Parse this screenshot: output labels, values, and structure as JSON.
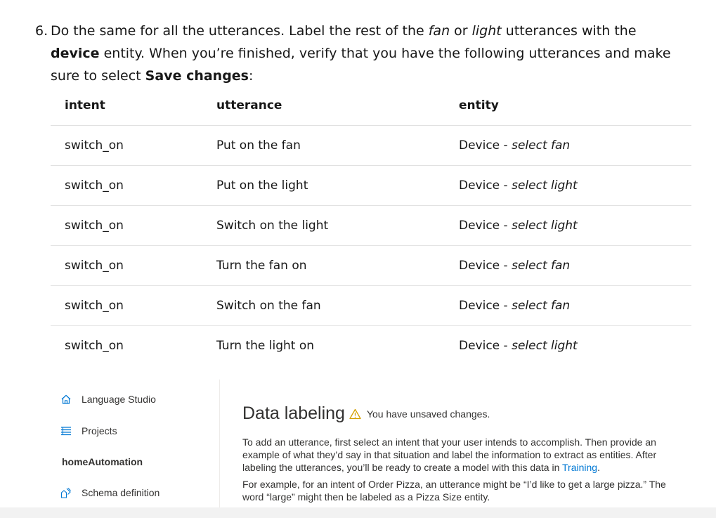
{
  "step": {
    "number": "6.",
    "t1": "Do the same for all the utterances. Label the rest of the ",
    "t2": "fan",
    "t3": " or ",
    "t4": "light",
    "t5": " utterances with the ",
    "t6": "device",
    "t7": " entity. When you’re finished, verify that you have the following utterances and make sure to select ",
    "t8": "Save changes",
    "t9": ":"
  },
  "table": {
    "headers": [
      "intent",
      "utterance",
      "entity"
    ],
    "rows": [
      {
        "intent": "switch_on",
        "utterance": "Put on the fan",
        "entity_prefix": "Device - ",
        "entity_select": "select fan"
      },
      {
        "intent": "switch_on",
        "utterance": "Put on the light",
        "entity_prefix": "Device - ",
        "entity_select": "select light"
      },
      {
        "intent": "switch_on",
        "utterance": "Switch on the light",
        "entity_prefix": "Device - ",
        "entity_select": "select light"
      },
      {
        "intent": "switch_on",
        "utterance": "Turn the fan on",
        "entity_prefix": "Device - ",
        "entity_select": "select fan"
      },
      {
        "intent": "switch_on",
        "utterance": "Switch on the fan",
        "entity_prefix": "Device - ",
        "entity_select": "select fan"
      },
      {
        "intent": "switch_on",
        "utterance": "Turn the light on",
        "entity_prefix": "Device - ",
        "entity_select": "select light"
      }
    ]
  },
  "screenshot": {
    "sidebar": {
      "language_studio": "Language Studio",
      "projects": "Projects",
      "project_name": "homeAutomation",
      "schema_definition": "Schema definition"
    },
    "title": "Data labeling",
    "unsaved": "You have unsaved changes.",
    "para1_text": "To add an utterance, first select an intent that your user intends to accomplish. Then provide an example of what they’d say in that situation and label the information to extract as entities. After labeling the utterances, you’ll be ready to create a model with this data in ",
    "para1_link": "Training",
    "para1_end": ".",
    "para2": "For example, for an intent of Order Pizza, an utterance might be “I’d like to get a large pizza.” The word “large” might then be labeled as a Pizza Size entity."
  },
  "colors": {
    "link": "#0078d4",
    "warning": "#d4a000",
    "border": "#e1e1e1"
  },
  "icons": [
    "home-icon",
    "list-icon",
    "schema-icon",
    "warning-icon"
  ]
}
